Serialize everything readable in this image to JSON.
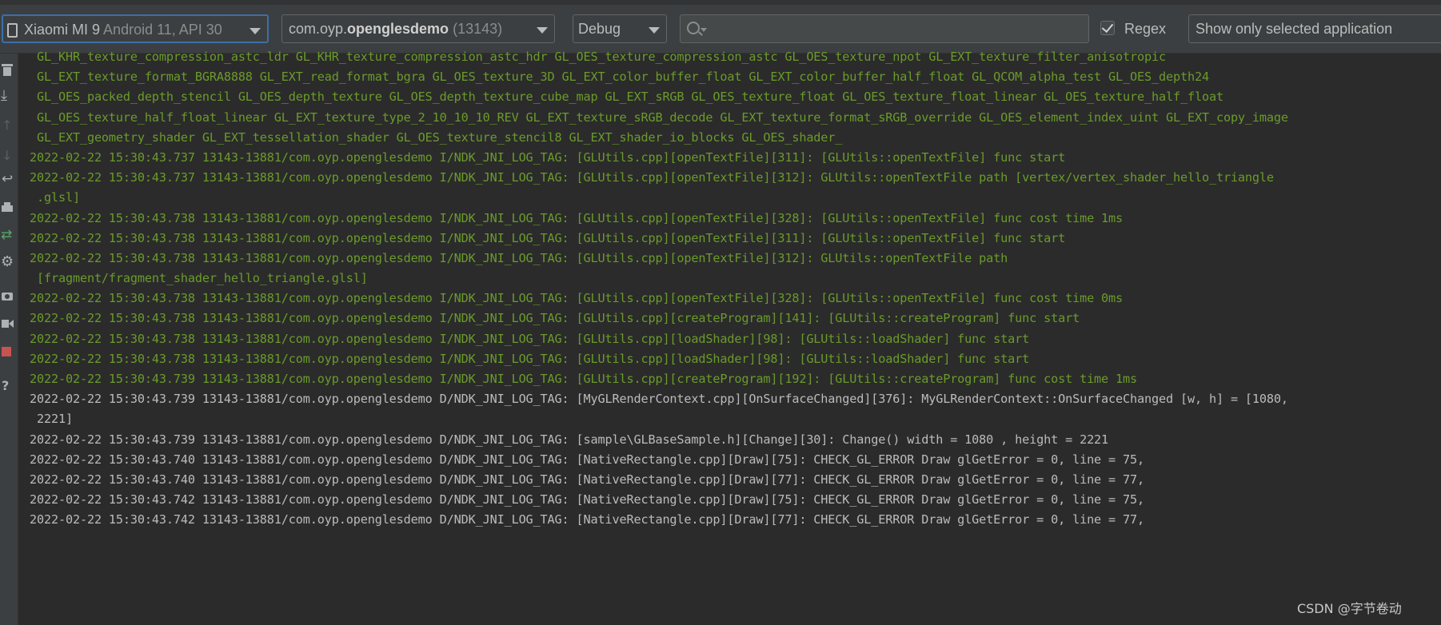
{
  "toolbar": {
    "device": {
      "name": "Xiaomi MI 9",
      "detail": "Android 11, API 30"
    },
    "process": {
      "prefix": "com.oyp.",
      "bold": "openglesdemo",
      "pid": "(13143)"
    },
    "log_level": "Debug",
    "search": {
      "value": "",
      "placeholder": ""
    },
    "regex": {
      "label": "Regex",
      "checked": true
    },
    "filter": "Show only selected application"
  },
  "sidebar_icons": [
    "trash-icon",
    "scroll-to-end-icon",
    "up-arrow-icon",
    "down-arrow-icon",
    "soft-wrap-icon",
    "print-icon",
    "restart-icon",
    "settings-gear-icon",
    "screen-capture-icon",
    "screen-record-icon",
    "terminate-icon",
    "help-icon"
  ],
  "log_lines": [
    {
      "level": "I",
      "text": " GL_KHR_texture_compression_astc_ldr GL_KHR_texture_compression_astc_hdr GL_OES_texture_compression_astc GL_OES_texture_npot GL_EXT_texture_filter_anisotropic"
    },
    {
      "level": "I",
      "text": " GL_EXT_texture_format_BGRA8888 GL_EXT_read_format_bgra GL_OES_texture_3D GL_EXT_color_buffer_float GL_EXT_color_buffer_half_float GL_QCOM_alpha_test GL_OES_depth24"
    },
    {
      "level": "I",
      "text": " GL_OES_packed_depth_stencil GL_OES_depth_texture GL_OES_depth_texture_cube_map GL_EXT_sRGB GL_OES_texture_float GL_OES_texture_float_linear GL_OES_texture_half_float"
    },
    {
      "level": "I",
      "text": " GL_OES_texture_half_float_linear GL_EXT_texture_type_2_10_10_10_REV GL_EXT_texture_sRGB_decode GL_EXT_texture_format_sRGB_override GL_OES_element_index_uint GL_EXT_copy_image"
    },
    {
      "level": "I",
      "text": " GL_EXT_geometry_shader GL_EXT_tessellation_shader GL_OES_texture_stencil8 GL_EXT_shader_io_blocks GL_OES_shader_"
    },
    {
      "level": "I",
      "text": "2022-02-22 15:30:43.737 13143-13881/com.oyp.openglesdemo I/NDK_JNI_LOG_TAG: [GLUtils.cpp][openTextFile][311]: [GLUtils::openTextFile] func start"
    },
    {
      "level": "I",
      "text": "2022-02-22 15:30:43.737 13143-13881/com.oyp.openglesdemo I/NDK_JNI_LOG_TAG: [GLUtils.cpp][openTextFile][312]: GLUtils::openTextFile path [vertex/vertex_shader_hello_triangle"
    },
    {
      "level": "I",
      "text": " .glsl]"
    },
    {
      "level": "I",
      "text": "2022-02-22 15:30:43.738 13143-13881/com.oyp.openglesdemo I/NDK_JNI_LOG_TAG: [GLUtils.cpp][openTextFile][328]: [GLUtils::openTextFile] func cost time 1ms"
    },
    {
      "level": "I",
      "text": "2022-02-22 15:30:43.738 13143-13881/com.oyp.openglesdemo I/NDK_JNI_LOG_TAG: [GLUtils.cpp][openTextFile][311]: [GLUtils::openTextFile] func start"
    },
    {
      "level": "I",
      "text": "2022-02-22 15:30:43.738 13143-13881/com.oyp.openglesdemo I/NDK_JNI_LOG_TAG: [GLUtils.cpp][openTextFile][312]: GLUtils::openTextFile path"
    },
    {
      "level": "I",
      "text": " [fragment/fragment_shader_hello_triangle.glsl]"
    },
    {
      "level": "I",
      "text": "2022-02-22 15:30:43.738 13143-13881/com.oyp.openglesdemo I/NDK_JNI_LOG_TAG: [GLUtils.cpp][openTextFile][328]: [GLUtils::openTextFile] func cost time 0ms"
    },
    {
      "level": "I",
      "text": "2022-02-22 15:30:43.738 13143-13881/com.oyp.openglesdemo I/NDK_JNI_LOG_TAG: [GLUtils.cpp][createProgram][141]: [GLUtils::createProgram] func start"
    },
    {
      "level": "I",
      "text": "2022-02-22 15:30:43.738 13143-13881/com.oyp.openglesdemo I/NDK_JNI_LOG_TAG: [GLUtils.cpp][loadShader][98]: [GLUtils::loadShader] func start"
    },
    {
      "level": "I",
      "text": "2022-02-22 15:30:43.738 13143-13881/com.oyp.openglesdemo I/NDK_JNI_LOG_TAG: [GLUtils.cpp][loadShader][98]: [GLUtils::loadShader] func start"
    },
    {
      "level": "I",
      "text": "2022-02-22 15:30:43.739 13143-13881/com.oyp.openglesdemo I/NDK_JNI_LOG_TAG: [GLUtils.cpp][createProgram][192]: [GLUtils::createProgram] func cost time 1ms"
    },
    {
      "level": "D",
      "text": "2022-02-22 15:30:43.739 13143-13881/com.oyp.openglesdemo D/NDK_JNI_LOG_TAG: [MyGLRenderContext.cpp][OnSurfaceChanged][376]: MyGLRenderContext::OnSurfaceChanged [w, h] = [1080,"
    },
    {
      "level": "D",
      "text": " 2221]"
    },
    {
      "level": "D",
      "text": "2022-02-22 15:30:43.739 13143-13881/com.oyp.openglesdemo D/NDK_JNI_LOG_TAG: [sample\\GLBaseSample.h][Change][30]: Change() width = 1080 , height = 2221"
    },
    {
      "level": "D",
      "text": "2022-02-22 15:30:43.740 13143-13881/com.oyp.openglesdemo D/NDK_JNI_LOG_TAG: [NativeRectangle.cpp][Draw][75]: CHECK_GL_ERROR Draw glGetError = 0, line = 75,"
    },
    {
      "level": "D",
      "text": "2022-02-22 15:30:43.740 13143-13881/com.oyp.openglesdemo D/NDK_JNI_LOG_TAG: [NativeRectangle.cpp][Draw][77]: CHECK_GL_ERROR Draw glGetError = 0, line = 77,"
    },
    {
      "level": "D",
      "text": "2022-02-22 15:30:43.742 13143-13881/com.oyp.openglesdemo D/NDK_JNI_LOG_TAG: [NativeRectangle.cpp][Draw][75]: CHECK_GL_ERROR Draw glGetError = 0, line = 75,"
    },
    {
      "level": "D",
      "text": "2022-02-22 15:30:43.742 13143-13881/com.oyp.openglesdemo D/NDK_JNI_LOG_TAG: [NativeRectangle.cpp][Draw][77]: CHECK_GL_ERROR Draw glGetError = 0, line = 77,"
    }
  ],
  "colors": {
    "info": "#6a9b2b",
    "debug": "#bbbbbb",
    "background": "#2b2b2b",
    "accent": "#3d6fa8"
  },
  "watermark": "CSDN @字节卷动"
}
